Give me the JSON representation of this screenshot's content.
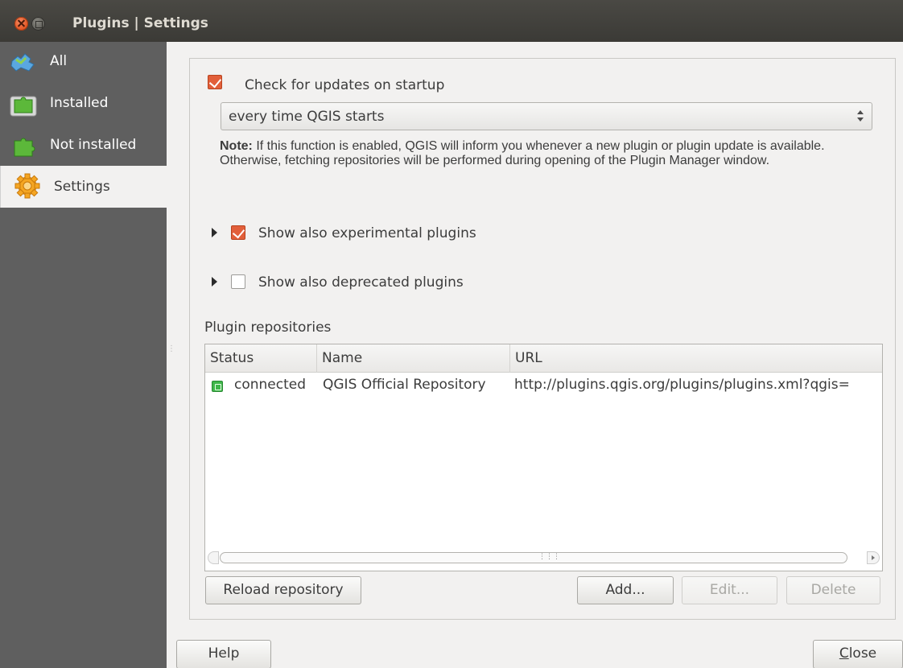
{
  "window": {
    "title": "Plugins | Settings"
  },
  "sidebar": {
    "items": [
      {
        "label": "All",
        "icon": "plugins-all-icon"
      },
      {
        "label": "Installed",
        "icon": "plugins-installed-icon"
      },
      {
        "label": "Not installed",
        "icon": "plugins-not-installed-icon"
      },
      {
        "label": "Settings",
        "icon": "settings-gear-icon",
        "active": true
      }
    ]
  },
  "settings": {
    "check_updates": {
      "label": "Check for updates on startup",
      "checked": true
    },
    "frequency": {
      "selected": "every time QGIS starts"
    },
    "note": {
      "bold": "Note:",
      "text": " If this function is enabled, QGIS will inform you whenever a new plugin or plugin update is available. Otherwise, fetching repositories will be performed during opening of the Plugin Manager window."
    },
    "experimental": {
      "label": "Show also experimental plugins",
      "checked": true
    },
    "deprecated": {
      "label": "Show also deprecated plugins",
      "checked": false
    },
    "repositories_label": "Plugin repositories"
  },
  "repositories": {
    "columns": [
      "Status",
      "Name",
      "URL"
    ],
    "rows": [
      {
        "status": "connected",
        "name": "QGIS Official Repository",
        "url": "http://plugins.qgis.org/plugins/plugins.xml?qgis="
      }
    ]
  },
  "buttons": {
    "reload": "Reload repository",
    "add": "Add...",
    "edit": "Edit...",
    "delete": "Delete",
    "help": "Help",
    "close_first": "C",
    "close_rest": "lose"
  },
  "colors": {
    "checkbox_accent": "#e25f3a",
    "sidebar_bg": "#5f5f5f",
    "status_connected": "#3fb64a"
  }
}
